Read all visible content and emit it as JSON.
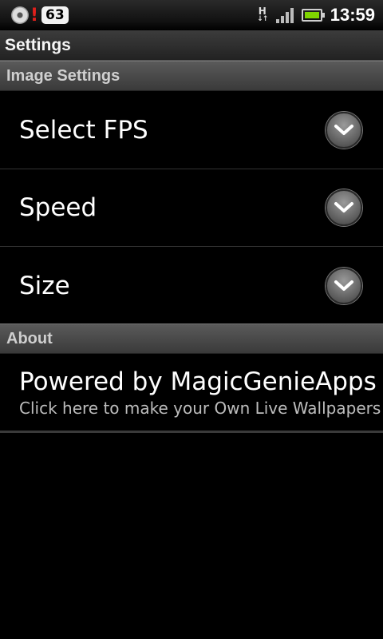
{
  "status_bar": {
    "notification_count": "63",
    "network_type": "H",
    "time": "13:59"
  },
  "title": "Settings",
  "sections": [
    {
      "header": "Image Settings",
      "items": [
        {
          "label": "Select FPS"
        },
        {
          "label": "Speed"
        },
        {
          "label": "Size"
        }
      ]
    },
    {
      "header": "About",
      "items": [
        {
          "title": "Powered by MagicGenieApps",
          "summary": "Click here to make your Own Live Wallpapers"
        }
      ]
    }
  ],
  "icons": {
    "dropdown": "chevron-down-icon",
    "battery_color": "#7fd400",
    "alert_color": "#e0201c"
  }
}
